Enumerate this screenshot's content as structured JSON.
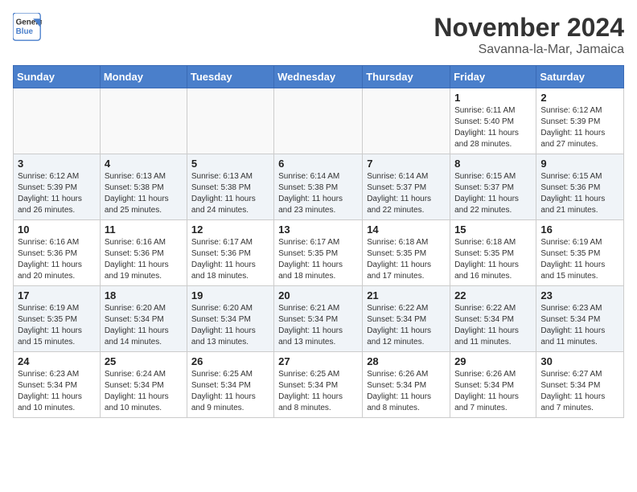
{
  "logo": {
    "line1": "General",
    "line2": "Blue"
  },
  "title": "November 2024",
  "location": "Savanna-la-Mar, Jamaica",
  "days_of_week": [
    "Sunday",
    "Monday",
    "Tuesday",
    "Wednesday",
    "Thursday",
    "Friday",
    "Saturday"
  ],
  "weeks": [
    [
      {
        "day": "",
        "info": ""
      },
      {
        "day": "",
        "info": ""
      },
      {
        "day": "",
        "info": ""
      },
      {
        "day": "",
        "info": ""
      },
      {
        "day": "",
        "info": ""
      },
      {
        "day": "1",
        "info": "Sunrise: 6:11 AM\nSunset: 5:40 PM\nDaylight: 11 hours and 28 minutes."
      },
      {
        "day": "2",
        "info": "Sunrise: 6:12 AM\nSunset: 5:39 PM\nDaylight: 11 hours and 27 minutes."
      }
    ],
    [
      {
        "day": "3",
        "info": "Sunrise: 6:12 AM\nSunset: 5:39 PM\nDaylight: 11 hours and 26 minutes."
      },
      {
        "day": "4",
        "info": "Sunrise: 6:13 AM\nSunset: 5:38 PM\nDaylight: 11 hours and 25 minutes."
      },
      {
        "day": "5",
        "info": "Sunrise: 6:13 AM\nSunset: 5:38 PM\nDaylight: 11 hours and 24 minutes."
      },
      {
        "day": "6",
        "info": "Sunrise: 6:14 AM\nSunset: 5:38 PM\nDaylight: 11 hours and 23 minutes."
      },
      {
        "day": "7",
        "info": "Sunrise: 6:14 AM\nSunset: 5:37 PM\nDaylight: 11 hours and 22 minutes."
      },
      {
        "day": "8",
        "info": "Sunrise: 6:15 AM\nSunset: 5:37 PM\nDaylight: 11 hours and 22 minutes."
      },
      {
        "day": "9",
        "info": "Sunrise: 6:15 AM\nSunset: 5:36 PM\nDaylight: 11 hours and 21 minutes."
      }
    ],
    [
      {
        "day": "10",
        "info": "Sunrise: 6:16 AM\nSunset: 5:36 PM\nDaylight: 11 hours and 20 minutes."
      },
      {
        "day": "11",
        "info": "Sunrise: 6:16 AM\nSunset: 5:36 PM\nDaylight: 11 hours and 19 minutes."
      },
      {
        "day": "12",
        "info": "Sunrise: 6:17 AM\nSunset: 5:36 PM\nDaylight: 11 hours and 18 minutes."
      },
      {
        "day": "13",
        "info": "Sunrise: 6:17 AM\nSunset: 5:35 PM\nDaylight: 11 hours and 18 minutes."
      },
      {
        "day": "14",
        "info": "Sunrise: 6:18 AM\nSunset: 5:35 PM\nDaylight: 11 hours and 17 minutes."
      },
      {
        "day": "15",
        "info": "Sunrise: 6:18 AM\nSunset: 5:35 PM\nDaylight: 11 hours and 16 minutes."
      },
      {
        "day": "16",
        "info": "Sunrise: 6:19 AM\nSunset: 5:35 PM\nDaylight: 11 hours and 15 minutes."
      }
    ],
    [
      {
        "day": "17",
        "info": "Sunrise: 6:19 AM\nSunset: 5:35 PM\nDaylight: 11 hours and 15 minutes."
      },
      {
        "day": "18",
        "info": "Sunrise: 6:20 AM\nSunset: 5:34 PM\nDaylight: 11 hours and 14 minutes."
      },
      {
        "day": "19",
        "info": "Sunrise: 6:20 AM\nSunset: 5:34 PM\nDaylight: 11 hours and 13 minutes."
      },
      {
        "day": "20",
        "info": "Sunrise: 6:21 AM\nSunset: 5:34 PM\nDaylight: 11 hours and 13 minutes."
      },
      {
        "day": "21",
        "info": "Sunrise: 6:22 AM\nSunset: 5:34 PM\nDaylight: 11 hours and 12 minutes."
      },
      {
        "day": "22",
        "info": "Sunrise: 6:22 AM\nSunset: 5:34 PM\nDaylight: 11 hours and 11 minutes."
      },
      {
        "day": "23",
        "info": "Sunrise: 6:23 AM\nSunset: 5:34 PM\nDaylight: 11 hours and 11 minutes."
      }
    ],
    [
      {
        "day": "24",
        "info": "Sunrise: 6:23 AM\nSunset: 5:34 PM\nDaylight: 11 hours and 10 minutes."
      },
      {
        "day": "25",
        "info": "Sunrise: 6:24 AM\nSunset: 5:34 PM\nDaylight: 11 hours and 10 minutes."
      },
      {
        "day": "26",
        "info": "Sunrise: 6:25 AM\nSunset: 5:34 PM\nDaylight: 11 hours and 9 minutes."
      },
      {
        "day": "27",
        "info": "Sunrise: 6:25 AM\nSunset: 5:34 PM\nDaylight: 11 hours and 8 minutes."
      },
      {
        "day": "28",
        "info": "Sunrise: 6:26 AM\nSunset: 5:34 PM\nDaylight: 11 hours and 8 minutes."
      },
      {
        "day": "29",
        "info": "Sunrise: 6:26 AM\nSunset: 5:34 PM\nDaylight: 11 hours and 7 minutes."
      },
      {
        "day": "30",
        "info": "Sunrise: 6:27 AM\nSunset: 5:34 PM\nDaylight: 11 hours and 7 minutes."
      }
    ]
  ]
}
